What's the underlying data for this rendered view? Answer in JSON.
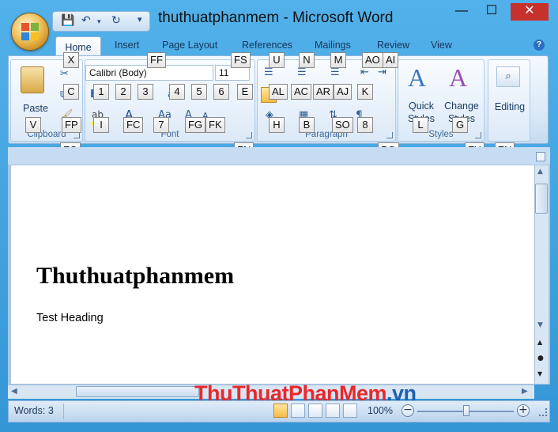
{
  "window": {
    "title": "thuthuatphanmem - Microsoft Word",
    "minimize": "—",
    "maximize": "☐",
    "close": "✕"
  },
  "qat": {
    "save_icon": "save-icon",
    "undo_icon": "undo-icon",
    "redo_icon": "redo-icon",
    "customize_icon": "customize-icon"
  },
  "tabs": {
    "home": "Home",
    "insert": "Insert",
    "page_layout": "Page Layout",
    "references": "References",
    "mailings": "Mailings",
    "review": "Review",
    "view": "View"
  },
  "ribbon": {
    "clipboard": {
      "label": "Clipboard",
      "paste": "Paste"
    },
    "font": {
      "label": "Font",
      "family": "Calibri (Body)",
      "size": "11"
    },
    "paragraph": {
      "label": "Paragraph"
    },
    "styles": {
      "label": "Styles",
      "quick_styles": "Quick Styles",
      "change_styles": "Change Styles"
    },
    "editing": {
      "label": "Editing"
    }
  },
  "keytips": {
    "x": "X",
    "ff": "FF",
    "fs": "FS",
    "u": "U",
    "n": "N",
    "m": "M",
    "ao": "AO",
    "ai": "AI",
    "c": "C",
    "k1": "1",
    "k2": "2",
    "k3": "3",
    "k4": "4",
    "k5": "5",
    "k6": "6",
    "e": "E",
    "al": "AL",
    "ac": "AC",
    "ar": "AR",
    "aj": "AJ",
    "k": "K",
    "v": "V",
    "fp": "FP",
    "i": "I",
    "fc": "FC",
    "k7": "7",
    "fg": "FG",
    "fk": "FK",
    "h": "H",
    "b": "B",
    "so": "SO",
    "k8": "8",
    "l": "L",
    "g": "G",
    "fo": "FO",
    "fn": "FN",
    "pg": "PG",
    "fy": "FY",
    "zn": "ZN"
  },
  "document": {
    "heading": "Thuthuatphanmem",
    "paragraph": "Test Heading"
  },
  "watermark": {
    "part1": "ThuThuat",
    "part2": "PhanMem",
    "part3": ".vn"
  },
  "status": {
    "words": "Words: 3",
    "zoom": "100%"
  },
  "colors": {
    "frame": "#3b9cdb",
    "ribbon": "#dce9f7",
    "close": "#c7312c",
    "watermark_red": "#e8282b",
    "watermark_blue": "#1d5fb6"
  }
}
